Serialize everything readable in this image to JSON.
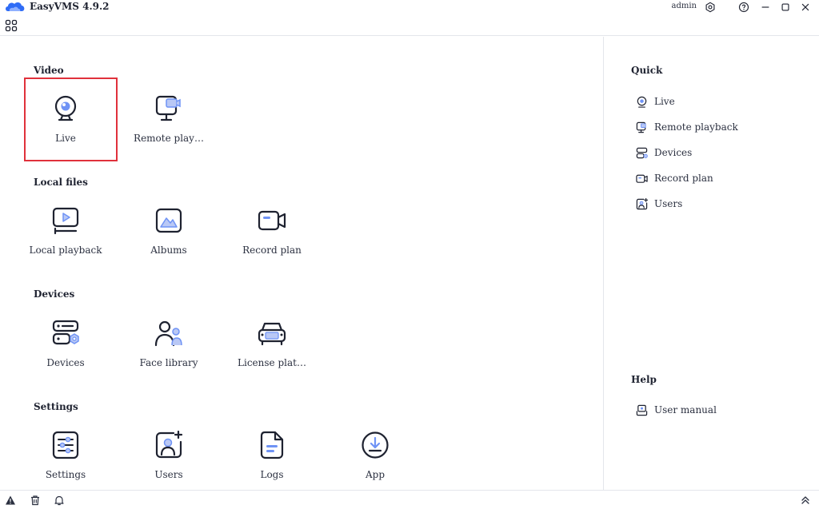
{
  "titlebar": {
    "app_title": "EasyVMS 4.9.2",
    "user": "admin"
  },
  "colors": {
    "accent": "#2f6cf6",
    "icon_stroke": "#1e2230",
    "icon_fill_light": "#b9c8f5",
    "selection": "#e0313b",
    "divider": "#e4e6eb"
  },
  "main": {
    "sections": [
      {
        "title": "Video",
        "tiles": [
          {
            "label": "Live",
            "icon": "webcam-icon"
          },
          {
            "label": "Remote play…",
            "icon": "remote-playback-icon"
          }
        ]
      },
      {
        "title": "Local files",
        "tiles": [
          {
            "label": "Local playback",
            "icon": "local-playback-icon"
          },
          {
            "label": "Albums",
            "icon": "albums-icon"
          },
          {
            "label": "Record plan",
            "icon": "record-plan-icon"
          }
        ]
      },
      {
        "title": "Devices",
        "tiles": [
          {
            "label": "Devices",
            "icon": "devices-icon"
          },
          {
            "label": "Face library",
            "icon": "face-library-icon"
          },
          {
            "label": "License plat…",
            "icon": "license-plate-icon"
          }
        ]
      },
      {
        "title": "Settings",
        "tiles": [
          {
            "label": "Settings",
            "icon": "settings-sliders-icon"
          },
          {
            "label": "Users",
            "icon": "add-user-icon"
          },
          {
            "label": "Logs",
            "icon": "logs-icon"
          },
          {
            "label": "App",
            "icon": "download-icon"
          }
        ]
      }
    ]
  },
  "side": {
    "quick_title": "Quick",
    "quick_items": [
      {
        "label": "Live",
        "icon": "webcam-icon"
      },
      {
        "label": "Remote playback",
        "icon": "remote-playback-icon"
      },
      {
        "label": "Devices",
        "icon": "devices-icon"
      },
      {
        "label": "Record plan",
        "icon": "record-plan-icon"
      },
      {
        "label": "Users",
        "icon": "users-icon"
      }
    ],
    "help_title": "Help",
    "help_items": [
      {
        "label": "User manual",
        "icon": "user-manual-icon"
      }
    ]
  }
}
